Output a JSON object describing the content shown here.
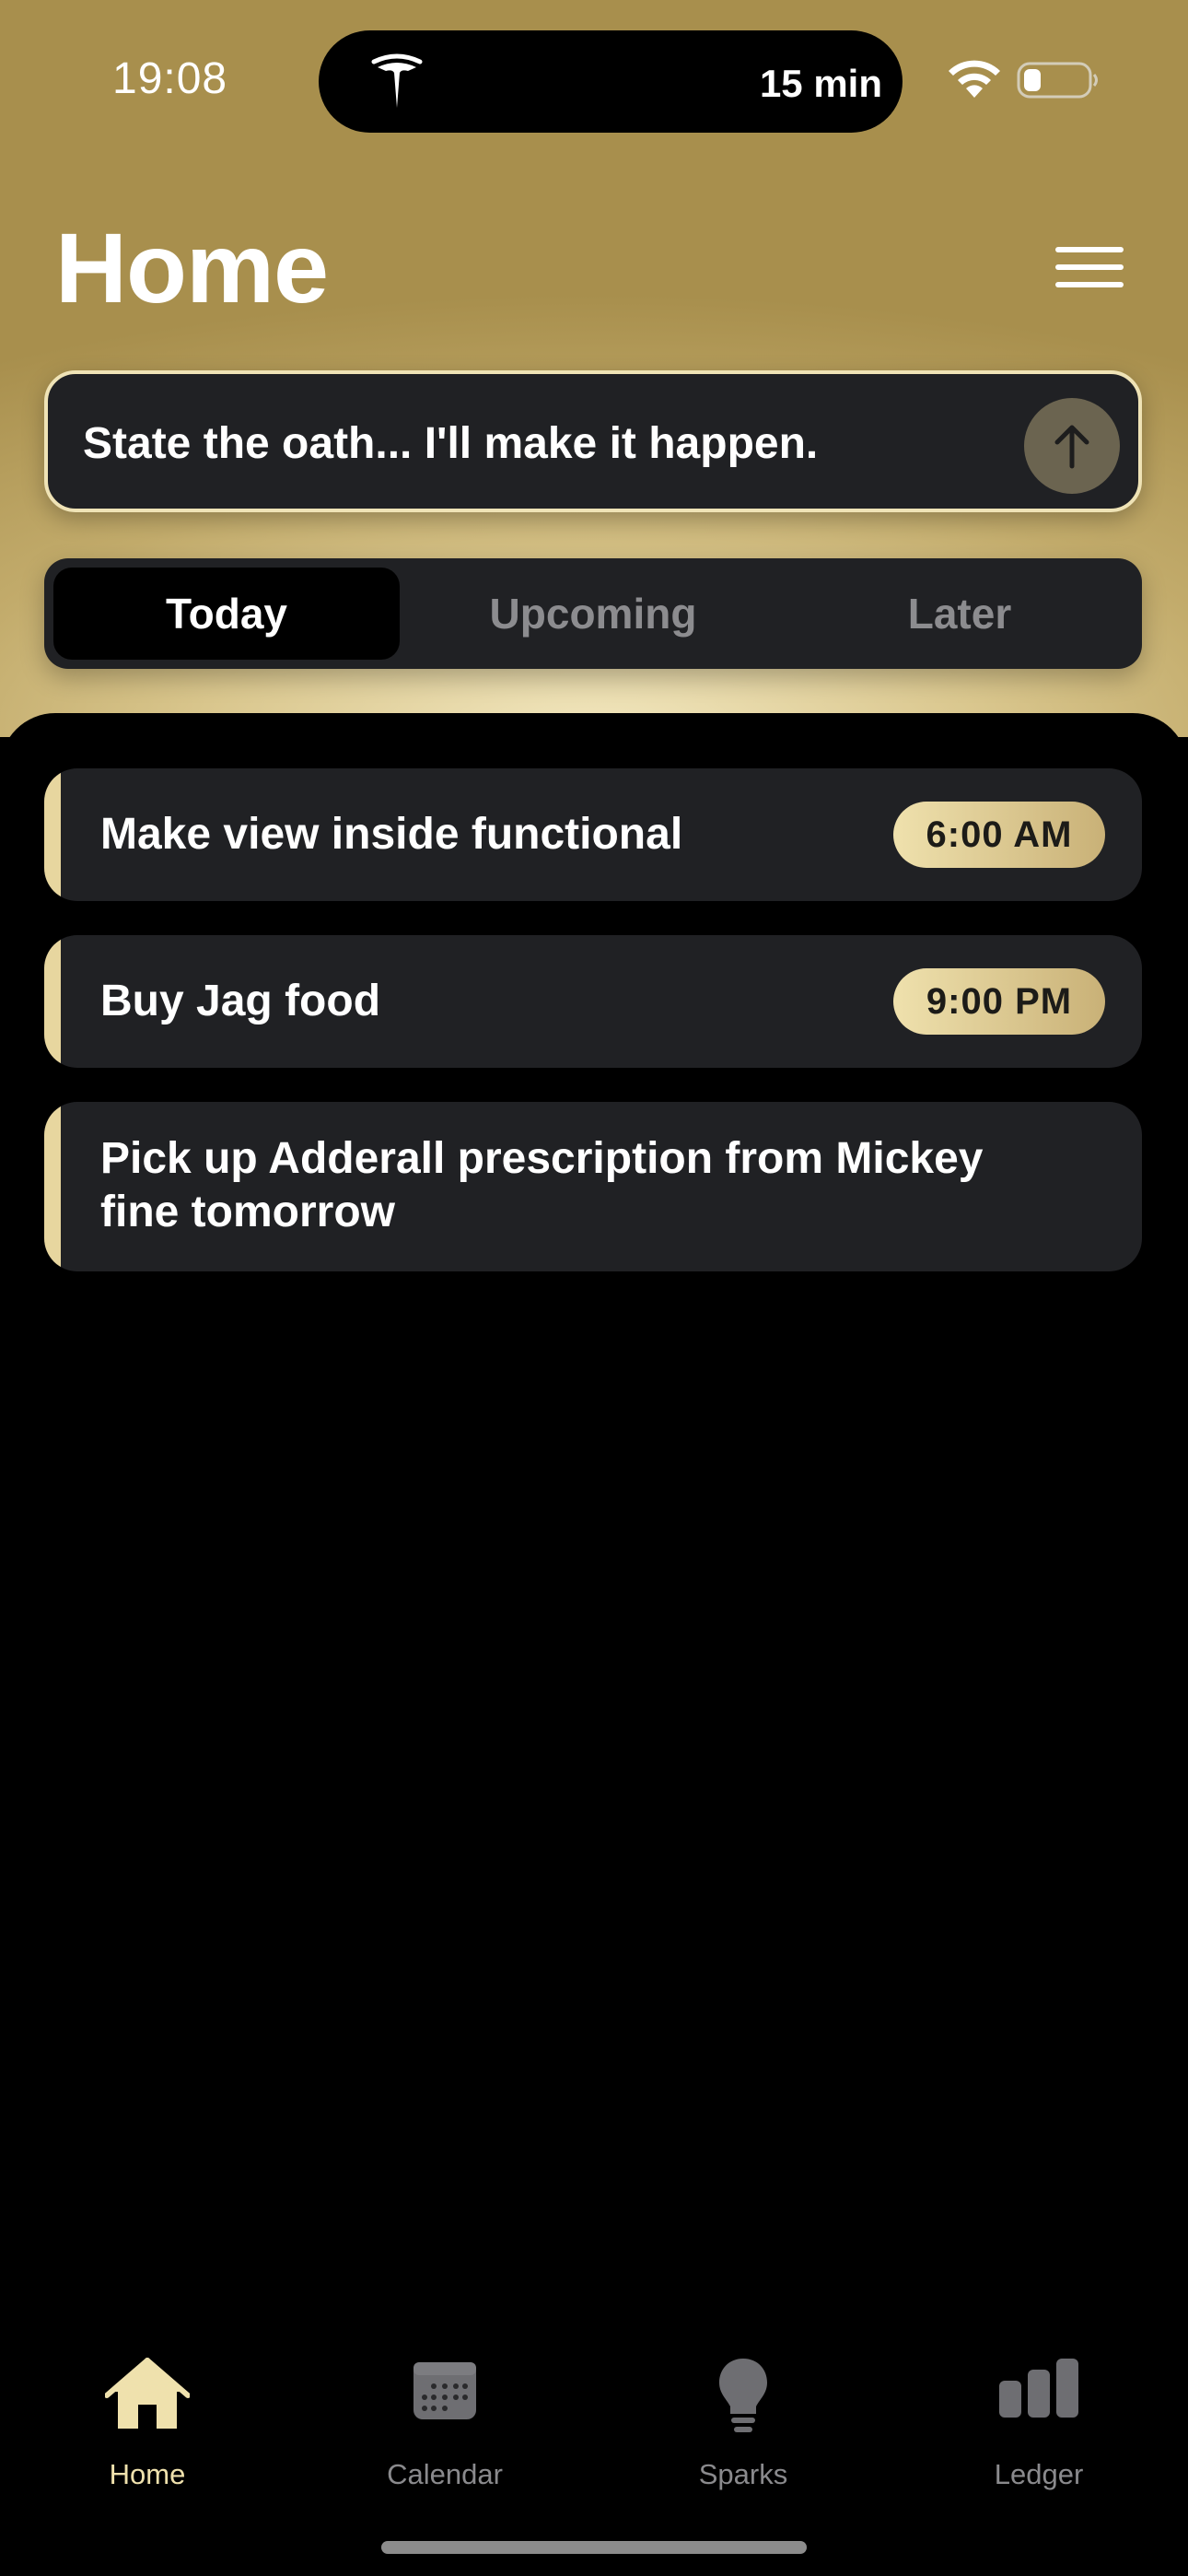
{
  "status_bar": {
    "time": "19:08",
    "island_text": "15 min",
    "island_icon": "tesla-logo-icon"
  },
  "header": {
    "title": "Home",
    "menu_icon": "hamburger-menu-icon"
  },
  "composer": {
    "placeholder": "State the oath... I'll make it happen.",
    "send_icon": "arrow-up-icon"
  },
  "segments": {
    "items": [
      {
        "label": "Today",
        "active": true
      },
      {
        "label": "Upcoming",
        "active": false
      },
      {
        "label": "Later",
        "active": false
      }
    ]
  },
  "tasks": {
    "items": [
      {
        "title": "Make view inside functional",
        "time": "6:00 AM"
      },
      {
        "title": "Buy Jag food",
        "time": "9:00 PM"
      },
      {
        "title": "Pick up Adderall prescription from Mickey fine tomorrow",
        "title_line1": "Pick up Adderall prescription from Mickey",
        "title_line2": "fine tomorrow",
        "time": ""
      }
    ]
  },
  "tabbar": {
    "items": [
      {
        "label": "Home",
        "icon": "house-icon",
        "active": true
      },
      {
        "label": "Calendar",
        "icon": "calendar-icon",
        "active": false
      },
      {
        "label": "Sparks",
        "icon": "lightbulb-icon",
        "active": false
      },
      {
        "label": "Ledger",
        "icon": "bar-chart-icon",
        "active": false
      }
    ]
  },
  "colors": {
    "accent": "#efe1ad",
    "card": "#202124",
    "inactive": "#8a8a8d"
  }
}
